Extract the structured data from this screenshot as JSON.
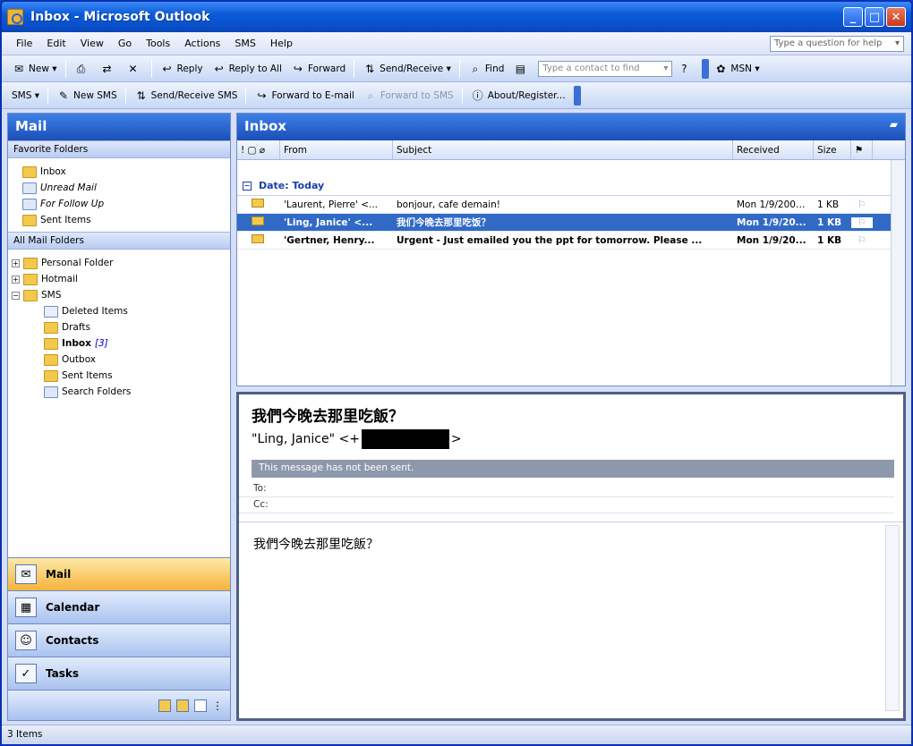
{
  "window": {
    "title": "Inbox - Microsoft Outlook"
  },
  "menu": {
    "items": [
      "File",
      "Edit",
      "View",
      "Go",
      "Tools",
      "Actions",
      "SMS",
      "Help"
    ],
    "help_placeholder": "Type a question for help"
  },
  "toolbar1": {
    "new": "New",
    "reply": "Reply",
    "reply_all": "Reply to All",
    "forward": "Forward",
    "send_receive": "Send/Receive",
    "find": "Find",
    "contact_placeholder": "Type a contact to find",
    "msn": "MSN"
  },
  "toolbar2": {
    "sms": "SMS",
    "new_sms": "New SMS",
    "send_receive_sms": "Send/Receive SMS",
    "forward_email": "Forward to E-mail",
    "forward_sms": "Forward to SMS",
    "about": "About/Register..."
  },
  "nav": {
    "header": "Mail",
    "favorites_title": "Favorite Folders",
    "favorites": [
      "Inbox",
      "Unread Mail",
      "For Follow Up",
      "Sent Items"
    ],
    "all_title": "All Mail Folders",
    "roots": [
      "Personal Folder",
      "Hotmail",
      "SMS"
    ],
    "sms_children": [
      "Deleted Items",
      "Drafts",
      "Inbox",
      "Outbox",
      "Sent Items",
      "Search Folders"
    ],
    "inbox_unread": "[3]",
    "buttons": [
      "Mail",
      "Calendar",
      "Contacts",
      "Tasks"
    ]
  },
  "inbox": {
    "header": "Inbox",
    "columns": {
      "from": "From",
      "subject": "Subject",
      "received": "Received",
      "size": "Size"
    },
    "group": "Date: Today",
    "rows": [
      {
        "from": "'Laurent, Pierre' <...",
        "subject": "bonjour, cafe demain!",
        "received": "Mon 1/9/2005...",
        "size": "1 KB"
      },
      {
        "from": "'Ling, Janice' <...",
        "subject": "我们今晚去那里吃饭？",
        "received": "Mon 1/9/20...",
        "size": "1 KB"
      },
      {
        "from": "'Gertner, Henry...",
        "subject": "Urgent - Just emailed you the ppt for tomorrow. Please ...",
        "received": "Mon 1/9/20...",
        "size": "1 KB"
      }
    ]
  },
  "reading": {
    "subject": "我們今晚去那里吃飯？",
    "from_prefix": "\"Ling, Janice\" <+",
    "from_suffix": ">",
    "banner": "This message has not been sent.",
    "to_label": "To:",
    "cc_label": "Cc:",
    "body": "我們今晚去那里吃飯？"
  },
  "status": {
    "text": "3 Items"
  }
}
